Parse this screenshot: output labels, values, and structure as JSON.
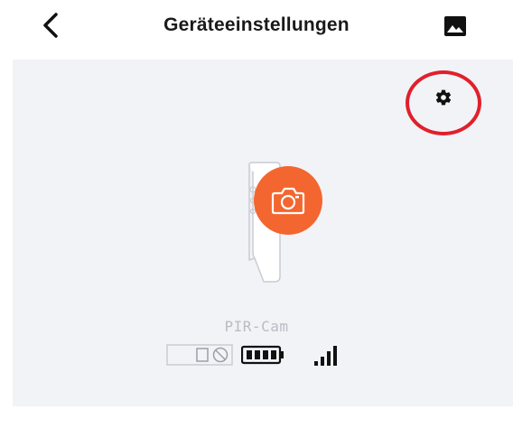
{
  "header": {
    "title": "Geräteeinstellungen",
    "back_icon": "chevron-left-icon",
    "gallery_icon": "image-icon"
  },
  "settings": {
    "icon": "gear-icon",
    "highlight_color": "#e0202b"
  },
  "device": {
    "name": "PIR-Cam",
    "snapshot_icon": "camera-icon",
    "accent_color": "#f4662f",
    "status": {
      "sd_card_icon": "sd-card-disabled-icon",
      "battery_icon": "battery-full-icon",
      "signal_icon": "signal-strength-icon"
    }
  }
}
